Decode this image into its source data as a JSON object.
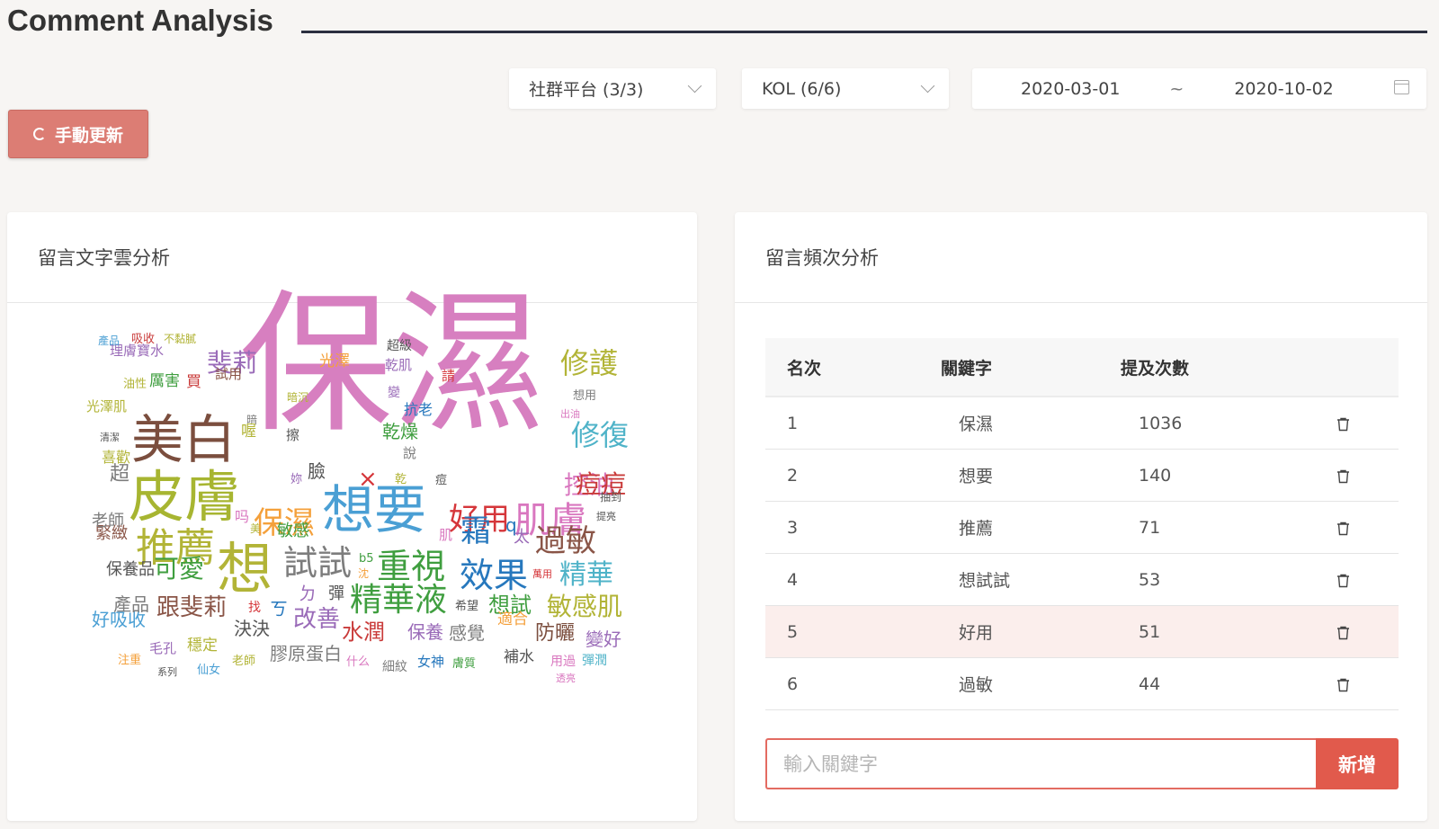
{
  "page": {
    "title": "Comment Analysis"
  },
  "filters": {
    "platform": "社群平台 (3/3)",
    "kol": "KOL (6/6)",
    "date_start": "2020-03-01",
    "date_sep": "~",
    "date_end": "2020-10-02"
  },
  "refresh_label": "手動更新",
  "wordcloud": {
    "title": "留言文字雲分析",
    "words": [
      {
        "t": "保濕",
        "s": 170,
        "c": "#d77fc0"
      },
      {
        "t": "皮膚",
        "s": 62,
        "c": "#a7b531"
      },
      {
        "t": "美白",
        "s": 58,
        "c": "#7b4e3e"
      },
      {
        "t": "想要",
        "s": 58,
        "c": "#4a9fd4"
      },
      {
        "t": "想",
        "s": 62,
        "c": "#b2b437"
      },
      {
        "t": "推薦",
        "s": 44,
        "c": "#b2b437"
      },
      {
        "t": "肌膚",
        "s": 40,
        "c": "#d977bf"
      },
      {
        "t": "修護",
        "s": 32,
        "c": "#b2b437"
      },
      {
        "t": "修復",
        "s": 32,
        "c": "#4fb3c8"
      },
      {
        "t": "控油",
        "s": 28,
        "c": "#d977bf"
      },
      {
        "t": "痘痘",
        "s": 28,
        "c": "#c93b3a"
      },
      {
        "t": "斐莉",
        "s": 28,
        "c": "#9a6bb8"
      },
      {
        "t": "保濕",
        "s": 34,
        "c": "#f4a03b"
      },
      {
        "t": "好用",
        "s": 34,
        "c": "#d5363a"
      },
      {
        "t": "試試",
        "s": 38,
        "c": "#7d7d7d"
      },
      {
        "t": "重視",
        "s": 38,
        "c": "#3f9e3f"
      },
      {
        "t": "效果",
        "s": 38,
        "c": "#2778bd"
      },
      {
        "t": "過敏",
        "s": 34,
        "c": "#8a5547"
      },
      {
        "t": "精華液",
        "s": 36,
        "c": "#3f9e3f"
      },
      {
        "t": "精華",
        "s": 30,
        "c": "#4fb3c8"
      },
      {
        "t": "敏感肌",
        "s": 28,
        "c": "#b2b437"
      },
      {
        "t": "霜",
        "s": 34,
        "c": "#2778bd"
      },
      {
        "t": "可愛",
        "s": 28,
        "c": "#3f9e3f"
      },
      {
        "t": "跟斐莉",
        "s": 26,
        "c": "#8a5547"
      },
      {
        "t": "改善",
        "s": 26,
        "c": "#9a6bb8"
      },
      {
        "t": "水潤",
        "s": 24,
        "c": "#c93b3a"
      },
      {
        "t": "想試",
        "s": 24,
        "c": "#3f9e3f"
      },
      {
        "t": "防曬",
        "s": 22,
        "c": "#7b4e3e"
      },
      {
        "t": "變好",
        "s": 20,
        "c": "#9a6bb8"
      },
      {
        "t": "保養",
        "s": 20,
        "c": "#9a6bb8"
      },
      {
        "t": "感覺",
        "s": 20,
        "c": "#7d7d7d"
      },
      {
        "t": "膠原蛋白",
        "s": 20,
        "c": "#7d7d7d"
      },
      {
        "t": "決決",
        "s": 20,
        "c": "#555555"
      },
      {
        "t": "好吸收",
        "s": 20,
        "c": "#4a9fd4"
      },
      {
        "t": "產品",
        "s": 20,
        "c": "#7d7d7d"
      },
      {
        "t": "保養品",
        "s": 18,
        "c": "#555555"
      },
      {
        "t": "緊緻",
        "s": 18,
        "c": "#8a5547"
      },
      {
        "t": "老師",
        "s": 18,
        "c": "#7d7d7d"
      },
      {
        "t": "超",
        "s": 22,
        "c": "#7d7d7d"
      },
      {
        "t": "喜歡",
        "s": 16,
        "c": "#b2b437"
      },
      {
        "t": "清潔",
        "s": 11,
        "c": "#555555"
      },
      {
        "t": "光澤肌",
        "s": 15,
        "c": "#b2b437"
      },
      {
        "t": "油性",
        "s": 13,
        "c": "#b2b437"
      },
      {
        "t": "厲害",
        "s": 17,
        "c": "#3f9e3f"
      },
      {
        "t": "買",
        "s": 17,
        "c": "#c93b3a"
      },
      {
        "t": "理膚寶水",
        "s": 15,
        "c": "#9a6bb8"
      },
      {
        "t": "產品",
        "s": 12,
        "c": "#4a9fd4"
      },
      {
        "t": "吸收",
        "s": 13,
        "c": "#c93b3a"
      },
      {
        "t": "不黏膩",
        "s": 12,
        "c": "#b2b437"
      },
      {
        "t": "光澤",
        "s": 17,
        "c": "#f4a03b"
      },
      {
        "t": "試用",
        "s": 15,
        "c": "#8a5547"
      },
      {
        "t": "超級",
        "s": 14,
        "c": "#555555"
      },
      {
        "t": "乾肌",
        "s": 15,
        "c": "#9a6bb8"
      },
      {
        "t": "請",
        "s": 15,
        "c": "#d5363a"
      },
      {
        "t": "暗沉",
        "s": 12,
        "c": "#b2b437"
      },
      {
        "t": "變",
        "s": 14,
        "c": "#9a6bb8"
      },
      {
        "t": "想用",
        "s": 13,
        "c": "#7d7d7d"
      },
      {
        "t": "抗老",
        "s": 16,
        "c": "#2778bd"
      },
      {
        "t": "出油",
        "s": 11,
        "c": "#d977bf"
      },
      {
        "t": "乾燥",
        "s": 20,
        "c": "#3f9e3f"
      },
      {
        "t": "暗",
        "s": 12,
        "c": "#7d7d7d"
      },
      {
        "t": "喔",
        "s": 17,
        "c": "#b2b437"
      },
      {
        "t": "擦",
        "s": 15,
        "c": "#555555"
      },
      {
        "t": "說",
        "s": 15,
        "c": "#7d7d7d"
      },
      {
        "t": "臉",
        "s": 20,
        "c": "#555555"
      },
      {
        "t": "×",
        "s": 26,
        "c": "#d5363a"
      },
      {
        "t": "乾",
        "s": 13,
        "c": "#b2b437"
      },
      {
        "t": "痘",
        "s": 13,
        "c": "#555555"
      },
      {
        "t": "妳",
        "s": 13,
        "c": "#9a6bb8"
      },
      {
        "t": "抽到",
        "s": 12,
        "c": "#555555"
      },
      {
        "t": "提亮",
        "s": 11,
        "c": "#555555"
      },
      {
        "t": "吗",
        "s": 16,
        "c": "#d977bf"
      },
      {
        "t": "美",
        "s": 12,
        "c": "#b2b437"
      },
      {
        "t": "敏感",
        "s": 18,
        "c": "#3f9e3f"
      },
      {
        "t": "q",
        "s": 20,
        "c": "#2778bd"
      },
      {
        "t": "肌",
        "s": 15,
        "c": "#d977bf"
      },
      {
        "t": "太",
        "s": 18,
        "c": "#9a6bb8"
      },
      {
        "t": "b5",
        "s": 13,
        "c": "#3f9e3f"
      },
      {
        "t": "沈",
        "s": 12,
        "c": "#f4a03b"
      },
      {
        "t": "萬用",
        "s": 11,
        "c": "#d5363a"
      },
      {
        "t": "ㄉ",
        "s": 20,
        "c": "#9a6bb8"
      },
      {
        "t": "彈",
        "s": 18,
        "c": "#555555"
      },
      {
        "t": "ㄎ",
        "s": 20,
        "c": "#2778bd"
      },
      {
        "t": "找",
        "s": 14,
        "c": "#d5363a"
      },
      {
        "t": "希望",
        "s": 13,
        "c": "#555555"
      },
      {
        "t": "適合",
        "s": 17,
        "c": "#f4a03b"
      },
      {
        "t": "補水",
        "s": 17,
        "c": "#555555"
      },
      {
        "t": "用過",
        "s": 14,
        "c": "#d977bf"
      },
      {
        "t": "彈潤",
        "s": 14,
        "c": "#4fb3c8"
      },
      {
        "t": "女神",
        "s": 15,
        "c": "#2778bd"
      },
      {
        "t": "膚質",
        "s": 13,
        "c": "#3f9e3f"
      },
      {
        "t": "細紋",
        "s": 14,
        "c": "#7d7d7d"
      },
      {
        "t": "什么",
        "s": 13,
        "c": "#d977bf"
      },
      {
        "t": "老師",
        "s": 13,
        "c": "#b2b437"
      },
      {
        "t": "穩定",
        "s": 17,
        "c": "#b2b437"
      },
      {
        "t": "毛孔",
        "s": 15,
        "c": "#9a6bb8"
      },
      {
        "t": "注重",
        "s": 13,
        "c": "#f4a03b"
      },
      {
        "t": "系列",
        "s": 11,
        "c": "#555555"
      },
      {
        "t": "仙女",
        "s": 13,
        "c": "#4a9fd4"
      },
      {
        "t": "透亮",
        "s": 11,
        "c": "#d977bf"
      }
    ]
  },
  "frequency": {
    "title": "留言頻次分析",
    "columns": [
      "名次",
      "關鍵字",
      "提及次數"
    ],
    "rows": [
      {
        "rank": "1",
        "keyword": "保濕",
        "count": "1036"
      },
      {
        "rank": "2",
        "keyword": "想要",
        "count": "140"
      },
      {
        "rank": "3",
        "keyword": "推薦",
        "count": "71"
      },
      {
        "rank": "4",
        "keyword": "想試試",
        "count": "53"
      },
      {
        "rank": "5",
        "keyword": "好用",
        "count": "51"
      },
      {
        "rank": "6",
        "keyword": "過敏",
        "count": "44"
      }
    ],
    "input_placeholder": "輸入關鍵字",
    "add_label": "新增"
  },
  "colors": {
    "accent": "#e15a4c",
    "refresh": "#dc7d74",
    "highlight_row": "#fbeeec"
  }
}
